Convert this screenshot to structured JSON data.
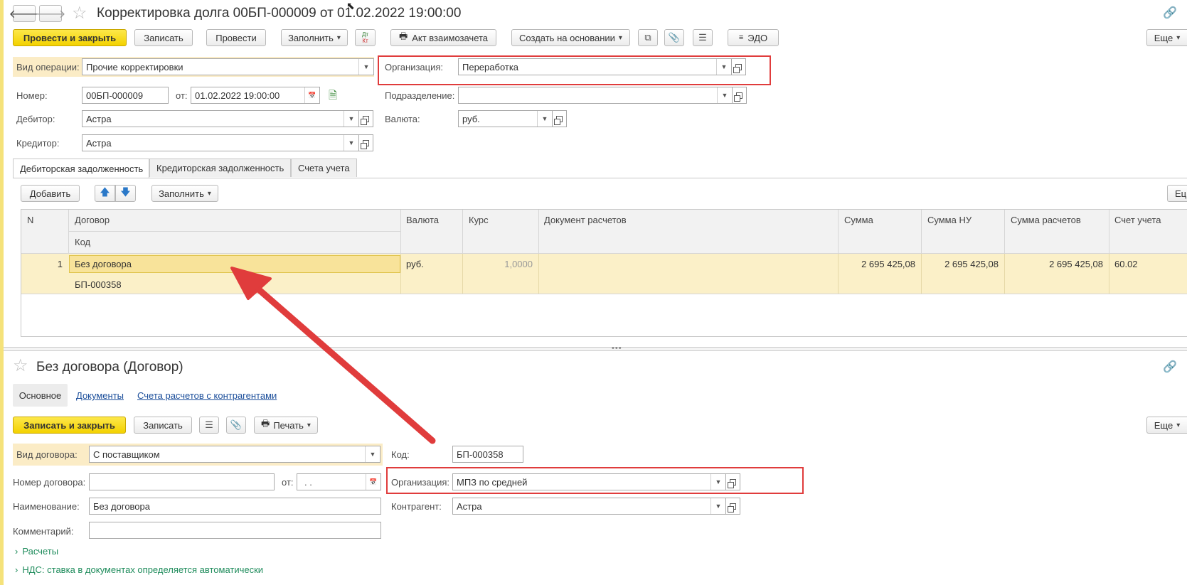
{
  "doc": {
    "title": "Корректировка долга 00БП-000009 от 01.02.2022 19:00:00",
    "toolbar": {
      "post_close": "Провести и закрыть",
      "save": "Записать",
      "post": "Провести",
      "fill": "Заполнить",
      "dtkt_top": "Дт",
      "dtkt_bottom": "Кт",
      "act": "Акт взаимозачета",
      "create_based": "Создать на основании",
      "edo": "ЭДО",
      "more": "Еще"
    },
    "fields": {
      "op_type_label": "Вид операции:",
      "op_type_value": "Прочие корректировки",
      "org_label": "Организация:",
      "org_value": "Переработка",
      "number_label": "Номер:",
      "number_value": "00БП-000009",
      "from_label": "от:",
      "date_value": "01.02.2022 19:00:00",
      "division_label": "Подразделение:",
      "division_value": "",
      "debtor_label": "Дебитор:",
      "debtor_value": "Астра",
      "currency_label": "Валюта:",
      "currency_value": "руб.",
      "creditor_label": "Кредитор:",
      "creditor_value": "Астра"
    },
    "tabs": [
      "Дебиторская задолженность",
      "Кредиторская задолженность",
      "Счета учета"
    ],
    "table_toolbar": {
      "add": "Добавить",
      "fill": "Заполнить",
      "more_partial": "Ец"
    },
    "table": {
      "headers": {
        "n": "N",
        "contract": "Договор",
        "code": "Код",
        "currency": "Валюта",
        "rate": "Курс",
        "settlement_doc": "Документ расчетов",
        "sum": "Сумма",
        "sum_nu": "Сумма НУ",
        "sum_settlement": "Сумма расчетов",
        "account": "Счет учета"
      },
      "rows": [
        {
          "n": "1",
          "contract": "Без договора",
          "code": "БП-000358",
          "currency": "руб.",
          "rate": "1,0000",
          "settlement_doc": "",
          "sum": "2 695 425,08",
          "sum_nu": "2 695 425,08",
          "sum_settlement": "2 695 425,08",
          "account": "60.02"
        }
      ]
    }
  },
  "contract": {
    "title": "Без договора (Договор)",
    "nav": [
      "Основное",
      "Документы",
      "Счета расчетов с контрагентами"
    ],
    "toolbar": {
      "save_close": "Записать и закрыть",
      "save": "Записать",
      "print": "Печать",
      "more": "Еще"
    },
    "fields": {
      "type_label": "Вид договора:",
      "type_value": "С поставщиком",
      "code_label": "Код:",
      "code_value": "БП-000358",
      "number_label": "Номер договора:",
      "number_value": "",
      "from_label": "от:",
      "date_value": " .  .",
      "org_label": "Организация:",
      "org_value": "МПЗ по средней",
      "name_label": "Наименование:",
      "name_value": "Без договора",
      "counterparty_label": "Контрагент:",
      "counterparty_value": "Астра",
      "comment_label": "Комментарий:",
      "comment_value": ""
    },
    "sections": [
      "Расчеты",
      "НДС: ставка в документах определяется автоматически"
    ]
  },
  "colors": {
    "accent_yellow": "#f3d200",
    "highlight": "#fbecc6",
    "annotation_red": "#e03c3c",
    "link_blue": "#1a4d9a",
    "section_green": "#1f8c5c"
  }
}
